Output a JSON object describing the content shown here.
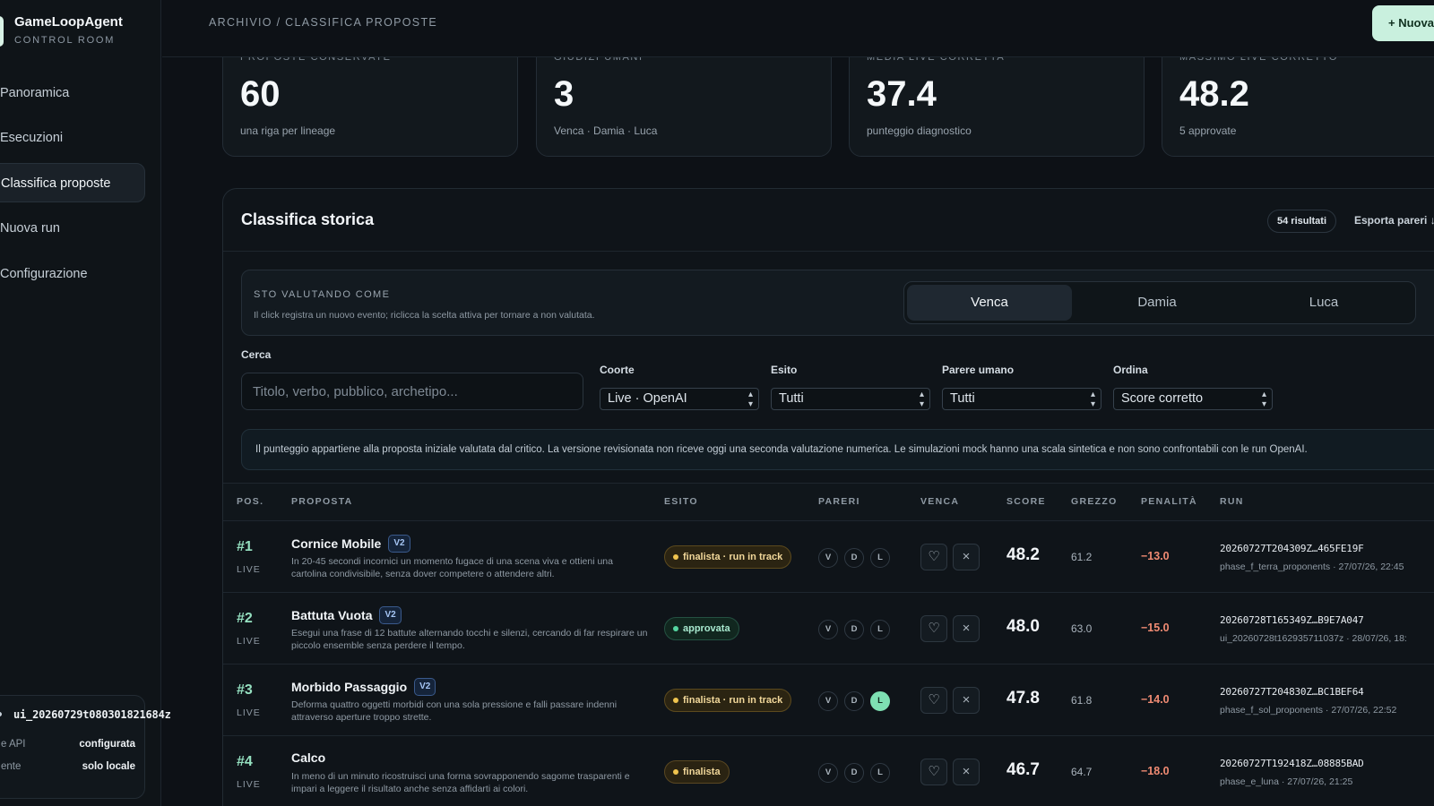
{
  "sidebar": {
    "brand_name": "GameLoopAgent",
    "brand_sub": "CONTROL ROOM",
    "nav": [
      {
        "label": "Panoramica"
      },
      {
        "label": "Esecuzioni"
      },
      {
        "label": "Classifica proposte"
      },
      {
        "label": "Nuova run"
      },
      {
        "label": "Configurazione"
      }
    ],
    "status": {
      "run": "ui_20260729t080301821684z",
      "rows": [
        {
          "key": "e API",
          "value": "configurata"
        },
        {
          "key": "ente",
          "value": "solo locale"
        }
      ]
    }
  },
  "topbar": {
    "breadcrumb": "ARCHIVIO / CLASSIFICA PROPOSTE",
    "new_button": "+  Nuova"
  },
  "stats": [
    {
      "label": "PROPOSTE CONSERVATE",
      "value": "60",
      "sub": "una riga per lineage"
    },
    {
      "label": "GIUDIZI UMANI",
      "value": "3",
      "sub": "Venca · Damia · Luca"
    },
    {
      "label": "MEDIA LIVE CORRETTA",
      "value": "37.4",
      "sub": "punteggio diagnostico"
    },
    {
      "label": "MASSIMO LIVE CORRETTO",
      "value": "48.2",
      "sub": "5 approvate"
    }
  ],
  "panel": {
    "title": "Classifica storica",
    "results_badge": "54 risultati",
    "export_link": "Esporta pareri ↓",
    "eval": {
      "label": "STO VALUTANDO COME",
      "hint": "Il click registra un nuovo evento; riclicca la scelta attiva per tornare a non valutata.",
      "options": [
        "Venca",
        "Damia",
        "Luca"
      ],
      "active": "Venca"
    },
    "filters": {
      "search_label": "Cerca",
      "search_placeholder": "Titolo, verbo, pubblico, archetipo...",
      "cohort_label": "Coorte",
      "cohort_value": "Live · OpenAI",
      "outcome_label": "Esito",
      "outcome_value": "Tutti",
      "human_label": "Parere umano",
      "human_value": "Tutti",
      "order_label": "Ordina",
      "order_value": "Score corretto"
    },
    "note": "Il punteggio appartiene alla proposta iniziale valutata dal critico. La versione revisionata non riceve oggi una seconda valutazione numerica. Le simulazioni mock hanno una scala sintetica e non sono confrontabili con le run OpenAI.",
    "columns": {
      "pos": "POS.",
      "proposal": "PROPOSTA",
      "outcome": "ESITO",
      "opinions": "PARERI",
      "venca": "VENCA",
      "score": "SCORE",
      "raw": "GREZZO",
      "penalty": "PENALITÀ",
      "run": "RUN"
    },
    "rows": [
      {
        "pos": "#1",
        "cohort": "LIVE",
        "title": "Cornice Mobile",
        "version": "V2",
        "desc": "In 20-45 secondi incornici un momento fugace di una scena viva e ottieni una cartolina condivisibile, senza dover competere o attendere altri.",
        "outcome": "finalista · run in track",
        "opinions": [
          "V",
          "D",
          "L"
        ],
        "heart": "♡",
        "cross": "×",
        "score": "48.2",
        "raw": "61.2",
        "penalty": "−13.0",
        "run_id": "20260727T204309Z…465FE19F",
        "run_meta": "phase_f_terra_proponents · 27/07/26, 22:45"
      },
      {
        "pos": "#2",
        "cohort": "LIVE",
        "title": "Battuta Vuota",
        "version": "V2",
        "desc": "Esegui una frase di 12 battute alternando tocchi e silenzi, cercando di far respirare un piccolo ensemble senza perdere il tempo.",
        "outcome": "approvata",
        "opinions": [
          "V",
          "D",
          "L"
        ],
        "heart": "♡",
        "cross": "×",
        "score": "48.0",
        "raw": "63.0",
        "penalty": "−15.0",
        "run_id": "20260728T165349Z…B9E7A047",
        "run_meta": "ui_20260728t162935711037z · 28/07/26, 18:"
      },
      {
        "pos": "#3",
        "cohort": "LIVE",
        "title": "Morbido Passaggio",
        "version": "V2",
        "desc": "Deforma quattro oggetti morbidi con una sola pressione e falli passare indenni attraverso aperture troppo strette.",
        "outcome": "finalista · run in track",
        "opinions": [
          "V",
          "D",
          "L"
        ],
        "heart": "♡",
        "cross": "×",
        "score": "47.8",
        "raw": "61.8",
        "penalty": "−14.0",
        "run_id": "20260727T204830Z…BC1BEF64",
        "run_meta": "phase_f_sol_proponents · 27/07/26, 22:52"
      },
      {
        "pos": "#4",
        "cohort": "LIVE",
        "title": "Calco",
        "version": "",
        "desc": "In meno di un minuto ricostruisci una forma sovrapponendo sagome trasparenti e impari a leggere il risultato anche senza affidarti ai colori.",
        "outcome": "finalista",
        "opinions": [
          "V",
          "D",
          "L"
        ],
        "heart": "♡",
        "cross": "×",
        "score": "46.7",
        "raw": "64.7",
        "penalty": "−18.0",
        "run_id": "20260727T192418Z…08885BAD",
        "run_meta": "phase_e_luna · 27/07/26, 21:25"
      }
    ]
  }
}
